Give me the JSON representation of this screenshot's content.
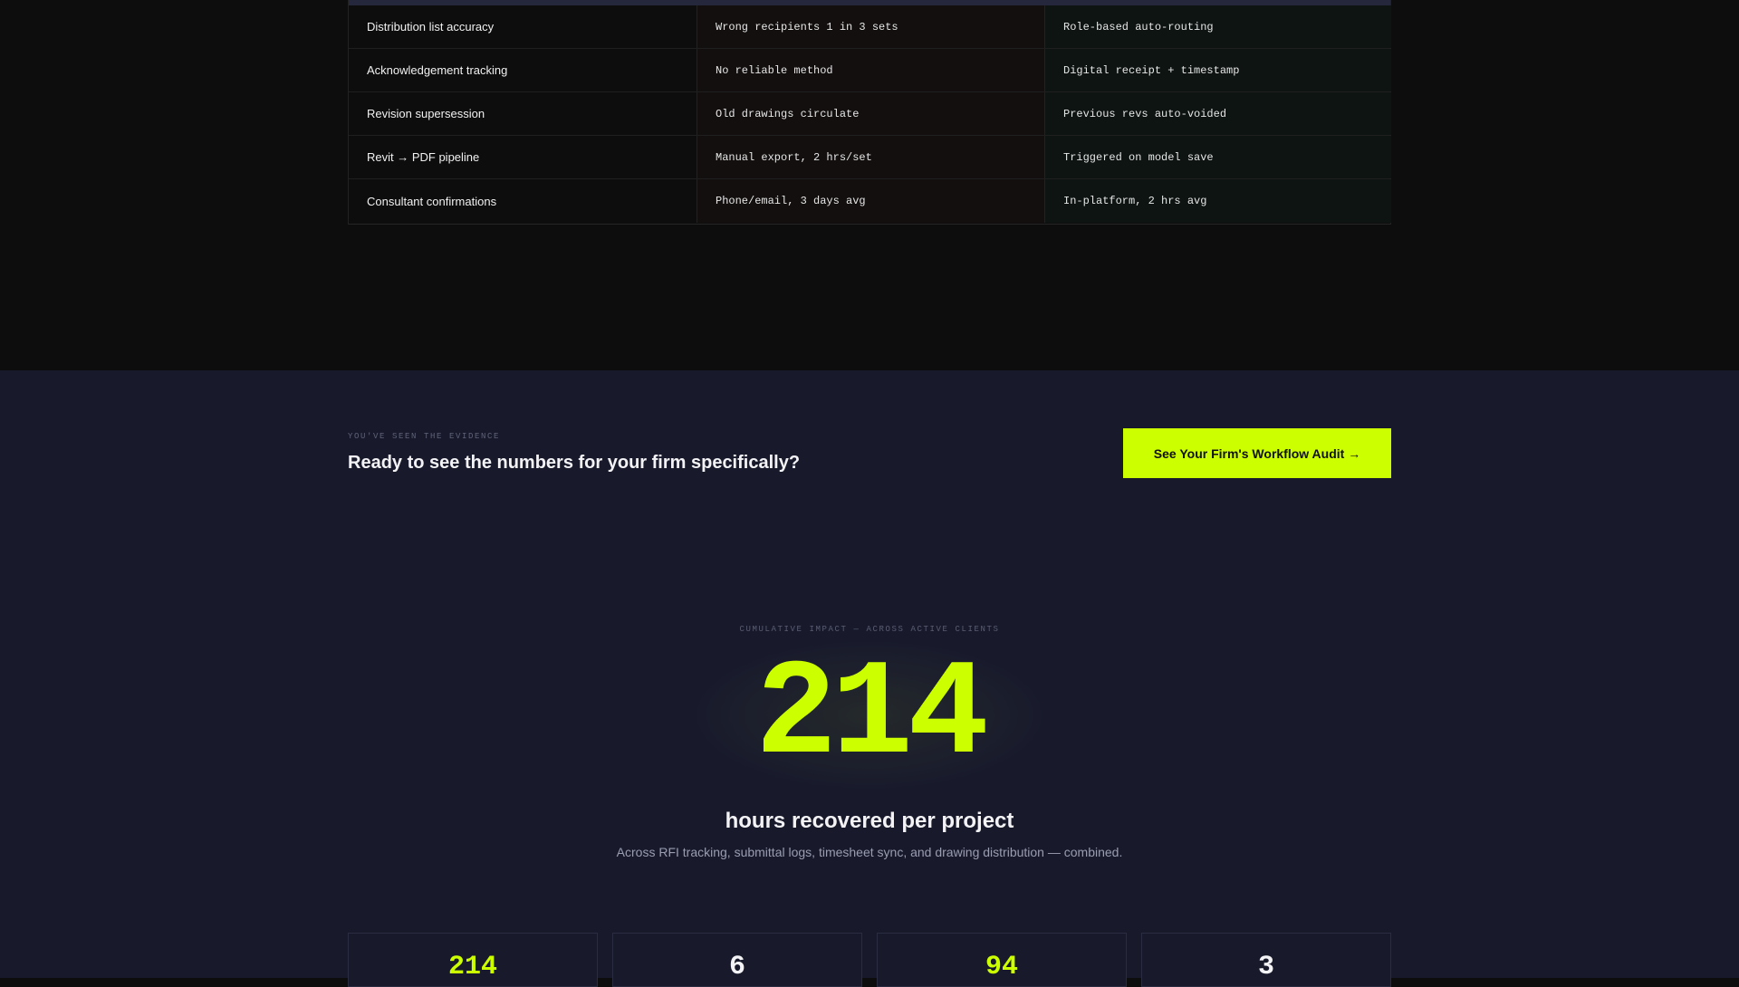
{
  "comparison": {
    "rows": [
      {
        "label": "Distribution list accuracy",
        "before": "Wrong recipients 1 in 3 sets",
        "after": "Role-based auto-routing"
      },
      {
        "label": "Acknowledgement tracking",
        "before": "No reliable method",
        "after": "Digital receipt + timestamp"
      },
      {
        "label": "Revision supersession",
        "before": "Old drawings circulate",
        "after": "Previous revs auto-voided"
      },
      {
        "label": "Revit → PDF pipeline",
        "before": "Manual export, 2 hrs/set",
        "after": "Triggered on model save"
      },
      {
        "label": "Consultant confirmations",
        "before": "Phone/email, 3 days avg",
        "after": "In-platform, 2 hrs avg"
      }
    ]
  },
  "cta": {
    "eyebrow": "YOU'VE SEEN THE EVIDENCE",
    "title": "Ready to see the numbers for your firm specifically?",
    "button_label": "See Your Firm's Workflow Audit →"
  },
  "impact": {
    "eyebrow": "CUMULATIVE IMPACT — ACROSS ACTIVE CLIENTS",
    "number": "214",
    "label": "hours recovered per project",
    "subtext": "Across RFI tracking, submittal logs, timesheet sync, and drawing distribution — combined."
  },
  "stats": [
    {
      "value": "214",
      "color": "#ccff00"
    },
    {
      "value": "6",
      "color": "#f3f3f6"
    },
    {
      "value": "94",
      "color": "#ccff00"
    },
    {
      "value": "3",
      "color": "#f3f3f6"
    }
  ],
  "colors": {
    "accent": "#ccff00",
    "band_background": "#181a2c",
    "page_background": "#0d0d0d"
  }
}
